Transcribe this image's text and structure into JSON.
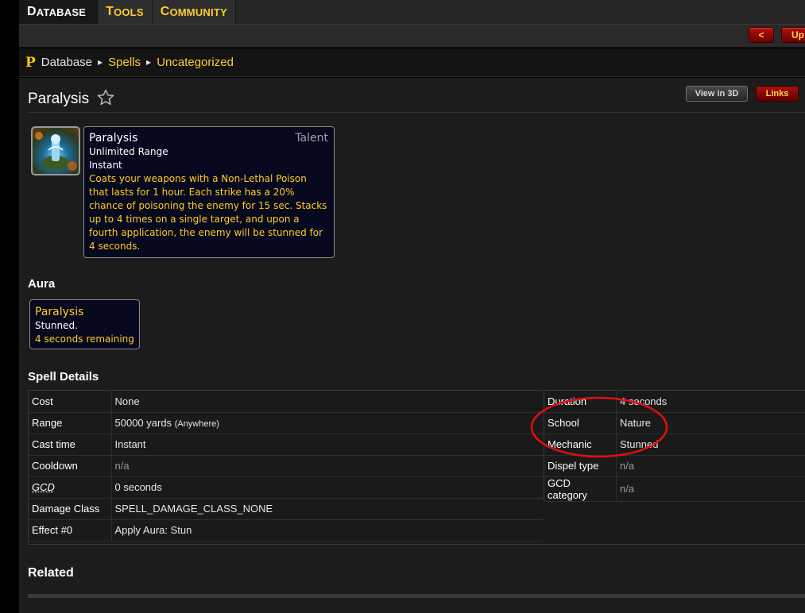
{
  "topnav": {
    "tabs": [
      {
        "first": "D",
        "rest": "ATABASE",
        "active": true
      },
      {
        "first": "T",
        "rest": "OOLS",
        "active": false
      },
      {
        "first": "C",
        "rest": "OMMUNITY",
        "active": false
      }
    ]
  },
  "subbar": {
    "back_label": "<",
    "up_label": "Up"
  },
  "breadcrumb": {
    "logo": "P",
    "items": [
      "Database",
      "Spells",
      "Uncategorized"
    ]
  },
  "page": {
    "title": "Paralysis",
    "view3d_label": "View in 3D",
    "links_label": "Links"
  },
  "tooltip": {
    "name": "Paralysis",
    "tag": "Talent",
    "range": "Unlimited Range",
    "cast": "Instant",
    "description": "Coats your weapons with a Non-Lethal Poison that lasts for 1 hour. Each strike has a 20% chance of poisoning the enemy for 15 sec. Stacks up to 4 times on a single target, and upon a fourth application, the enemy will be stunned for 4 seconds."
  },
  "aura": {
    "heading": "Aura",
    "name": "Paralysis",
    "description": "Stunned.",
    "remaining": "4 seconds remaining"
  },
  "spell_details": {
    "heading": "Spell Details",
    "left": [
      {
        "key": "Cost",
        "value": "None"
      },
      {
        "key": "Range",
        "value": "50000 yards",
        "note": "(Anywhere)"
      },
      {
        "key": "Cast time",
        "value": "Instant"
      },
      {
        "key": "Cooldown",
        "value": "n/a"
      },
      {
        "key": "GCD",
        "value": "0 seconds"
      },
      {
        "key": "Damage Class",
        "value": "SPELL_DAMAGE_CLASS_NONE"
      },
      {
        "key": "Effect #0",
        "value": "Apply Aura: Stun"
      }
    ],
    "right": [
      {
        "key": "Duration",
        "value": "4 seconds"
      },
      {
        "key": "School",
        "value": "Nature"
      },
      {
        "key": "Mechanic",
        "value": "Stunned"
      },
      {
        "key": "Dispel type",
        "value": "n/a"
      },
      {
        "key": "GCD category",
        "value": "n/a"
      }
    ]
  },
  "related": {
    "heading": "Related"
  },
  "colors": {
    "gold": "#ffcc33",
    "tooltip_bg": "#070a1e",
    "annotation": "#e01010"
  },
  "icons": [
    "star-icon",
    "breadcrumb-arrow-icon",
    "spell-icon"
  ]
}
